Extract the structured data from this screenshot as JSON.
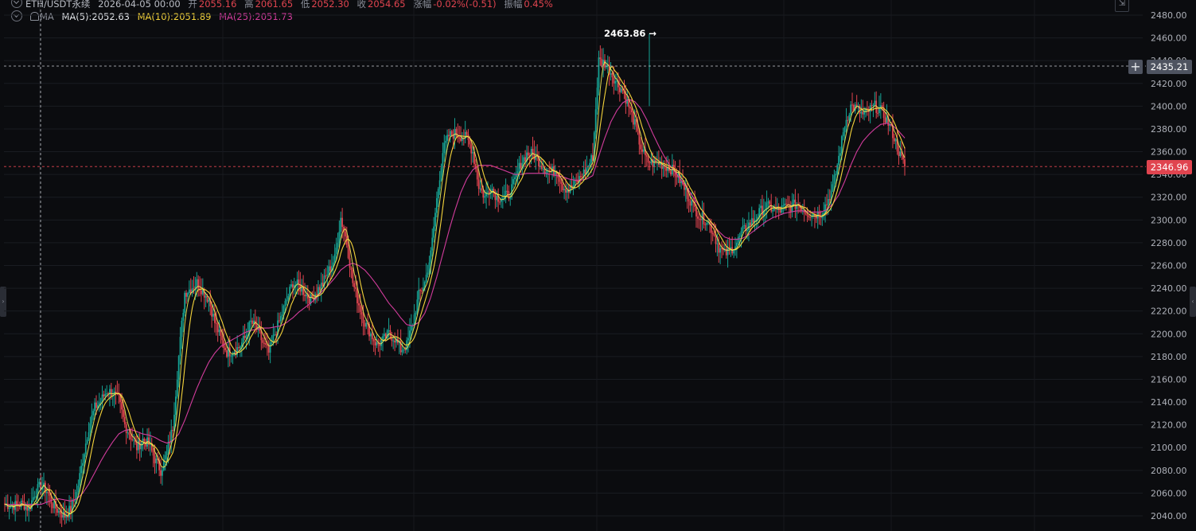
{
  "header": {
    "symbol": "ETH/USDT永续",
    "time": "2026-04-05 00:00",
    "open_label": "开",
    "open": "2055.16",
    "high_label": "高",
    "high": "2061.65",
    "low_label": "低",
    "low": "2052.30",
    "close_label": "收",
    "close": "2054.65",
    "change_label": "涨幅",
    "change": "-0.02%(-0.51)",
    "amplitude_label": "振幅",
    "amplitude": "0.45%"
  },
  "ma": {
    "indicator_label": "MA",
    "ma5": "MA(5):2052.63",
    "ma10": "MA(10):2051.89",
    "ma25": "MA(25):2051.73"
  },
  "annotations": {
    "high_marker": "2463.86 →",
    "crosshair_price": "2435.21",
    "last_price": "2346.96",
    "add_button": "+"
  },
  "colors": {
    "up": "#16a394",
    "down": "#e0444f",
    "ma5": "#f2ea56",
    "ma10": "#f5d43b",
    "ma25": "#d23c9c",
    "last_price_bg": "#e0444f",
    "crosshair_bg": "#4e5360"
  },
  "icons": [
    "chevron-down-icon",
    "bell-icon",
    "expand-icon",
    "plus-icon"
  ],
  "chart_data": {
    "type": "candlestick",
    "y_ticks": [
      "2480.00",
      "2460.00",
      "2440.00",
      "2420.00",
      "2400.00",
      "2380.00",
      "2360.00",
      "2340.00",
      "2320.00",
      "2300.00",
      "2280.00",
      "2260.00",
      "2240.00",
      "2220.00",
      "2200.00",
      "2180.00",
      "2160.00",
      "2140.00",
      "2120.00",
      "2100.00",
      "2080.00",
      "2060.00",
      "2040.00"
    ],
    "ylim": [
      2030,
      2490
    ],
    "grid": true,
    "series": [
      {
        "name": "MA(5)",
        "role": "ma5"
      },
      {
        "name": "MA(10)",
        "role": "ma10"
      },
      {
        "name": "MA(25)",
        "role": "ma25"
      }
    ],
    "close_path": [
      2050,
      2050,
      2049,
      2051,
      2046,
      2060,
      2067,
      2062,
      2050,
      2044,
      2040,
      2046,
      2060,
      2090,
      2118,
      2135,
      2141,
      2150,
      2148,
      2142,
      2120,
      2110,
      2100,
      2107,
      2103,
      2090,
      2080,
      2095,
      2118,
      2180,
      2236,
      2240,
      2245,
      2238,
      2230,
      2210,
      2196,
      2184,
      2185,
      2188,
      2196,
      2210,
      2205,
      2192,
      2183,
      2200,
      2214,
      2230,
      2245,
      2242,
      2236,
      2230,
      2238,
      2244,
      2256,
      2266,
      2302,
      2280,
      2245,
      2226,
      2210,
      2200,
      2190,
      2194,
      2200,
      2196,
      2186,
      2190,
      2210,
      2234,
      2245,
      2270,
      2318,
      2360,
      2374,
      2376,
      2374,
      2372,
      2360,
      2330,
      2320,
      2330,
      2320,
      2320,
      2322,
      2334,
      2350,
      2358,
      2358,
      2352,
      2345,
      2342,
      2344,
      2330,
      2326,
      2331,
      2338,
      2345,
      2356,
      2440,
      2438,
      2430,
      2420,
      2414,
      2400,
      2384,
      2364,
      2352,
      2350,
      2350,
      2348,
      2345,
      2340,
      2330,
      2320,
      2310,
      2302,
      2300,
      2290,
      2276,
      2270,
      2274,
      2280,
      2290,
      2296,
      2301,
      2308,
      2312,
      2310,
      2308,
      2311,
      2312,
      2314,
      2310,
      2306,
      2305,
      2306,
      2315,
      2328,
      2355,
      2384,
      2400,
      2398,
      2392,
      2396,
      2400,
      2396,
      2388,
      2376,
      2360,
      2347
    ],
    "ma25_path": [
      2050,
      2050,
      2050,
      2050,
      2050,
      2050,
      2050,
      2052,
      2054,
      2055,
      2054,
      2053,
      2055,
      2060,
      2068,
      2078,
      2088,
      2097,
      2105,
      2112,
      2115,
      2116,
      2114,
      2112,
      2111,
      2109,
      2106,
      2104,
      2106,
      2112,
      2124,
      2138,
      2152,
      2164,
      2175,
      2183,
      2189,
      2192,
      2195,
      2198,
      2201,
      2203,
      2204,
      2205,
      2205,
      2206,
      2207,
      2210,
      2214,
      2219,
      2223,
      2227,
      2232,
      2238,
      2243,
      2249,
      2256,
      2260,
      2262,
      2260,
      2256,
      2250,
      2243,
      2235,
      2227,
      2221,
      2214,
      2208,
      2207,
      2210,
      2218,
      2232,
      2250,
      2270,
      2290,
      2308,
      2324,
      2336,
      2344,
      2348,
      2348,
      2348,
      2346,
      2344,
      2342,
      2340,
      2340,
      2341,
      2341,
      2341,
      2341,
      2340,
      2339,
      2338,
      2336,
      2335,
      2335,
      2336,
      2339,
      2356,
      2372,
      2386,
      2396,
      2403,
      2406,
      2404,
      2398,
      2388,
      2376,
      2365,
      2355,
      2347,
      2340,
      2333,
      2326,
      2318,
      2310,
      2303,
      2296,
      2290,
      2285,
      2283,
      2283,
      2284,
      2287,
      2291,
      2295,
      2299,
      2302,
      2304,
      2306,
      2307,
      2308,
      2308,
      2307,
      2307,
      2307,
      2309,
      2314,
      2322,
      2334,
      2348,
      2360,
      2369,
      2375,
      2380,
      2384,
      2385,
      2383,
      2378,
      2372
    ]
  }
}
